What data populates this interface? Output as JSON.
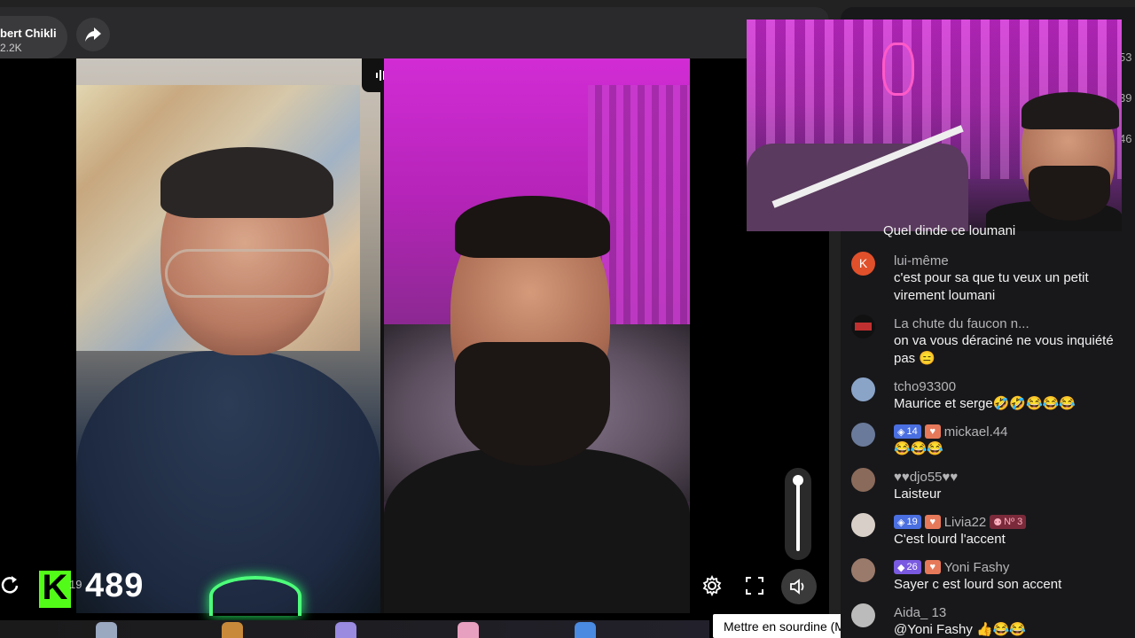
{
  "host": {
    "name": "bert Chikli",
    "followers": "2.2K"
  },
  "viewers": {
    "k_small": "19",
    "count": "489"
  },
  "tooltip": "Mettre en sourdine (M)",
  "volume_level": 1.0,
  "side_numbers": [
    "53",
    "39",
    "46"
  ],
  "chat": {
    "partial_top": "Quel dinde ce loumani",
    "messages": [
      {
        "user": "lui-même",
        "avatar_letter": "K",
        "avatar_color": "#e0502a",
        "text": "c'est pour sa que tu veux un petit virement loumani"
      },
      {
        "user": "La chute du faucon n...",
        "avatar_letter": "",
        "avatar_color": "#111111",
        "text": "on va vous déraciné ne vous inquiété pas 😑"
      },
      {
        "user": "tcho93300",
        "avatar_letter": "",
        "avatar_color": "#8aa4c8",
        "text": "Maurice et serge🤣🤣😂😂😂"
      },
      {
        "user": "mickael.44",
        "badge_level": "14",
        "avatar_letter": "",
        "avatar_color": "#6a7a9a",
        "text": "😂😂😂"
      },
      {
        "user": "♥♥djo55♥♥",
        "avatar_letter": "",
        "avatar_color": "#8a6a5a",
        "text": "Laisteur"
      },
      {
        "user": "Livia22",
        "badge_level": "19",
        "extra_badge": "Nº 3",
        "avatar_letter": "",
        "avatar_color": "#d8d0c8",
        "text": "C'est lourd l'accent"
      },
      {
        "user": "Yoni Fashy",
        "badge_level": "26",
        "avatar_letter": "",
        "avatar_color": "#9a7a6a",
        "text": "Sayer c est lourd son accent"
      },
      {
        "user": "Aida_ 13",
        "avatar_letter": "",
        "avatar_color": "#bbbbbb",
        "text": "@Yoni Fashy 👍😂😂"
      }
    ]
  },
  "colors": {
    "kick_green": "#53fc18",
    "chat_bg": "#18181b",
    "badge_blue": "#4a6fe0"
  }
}
